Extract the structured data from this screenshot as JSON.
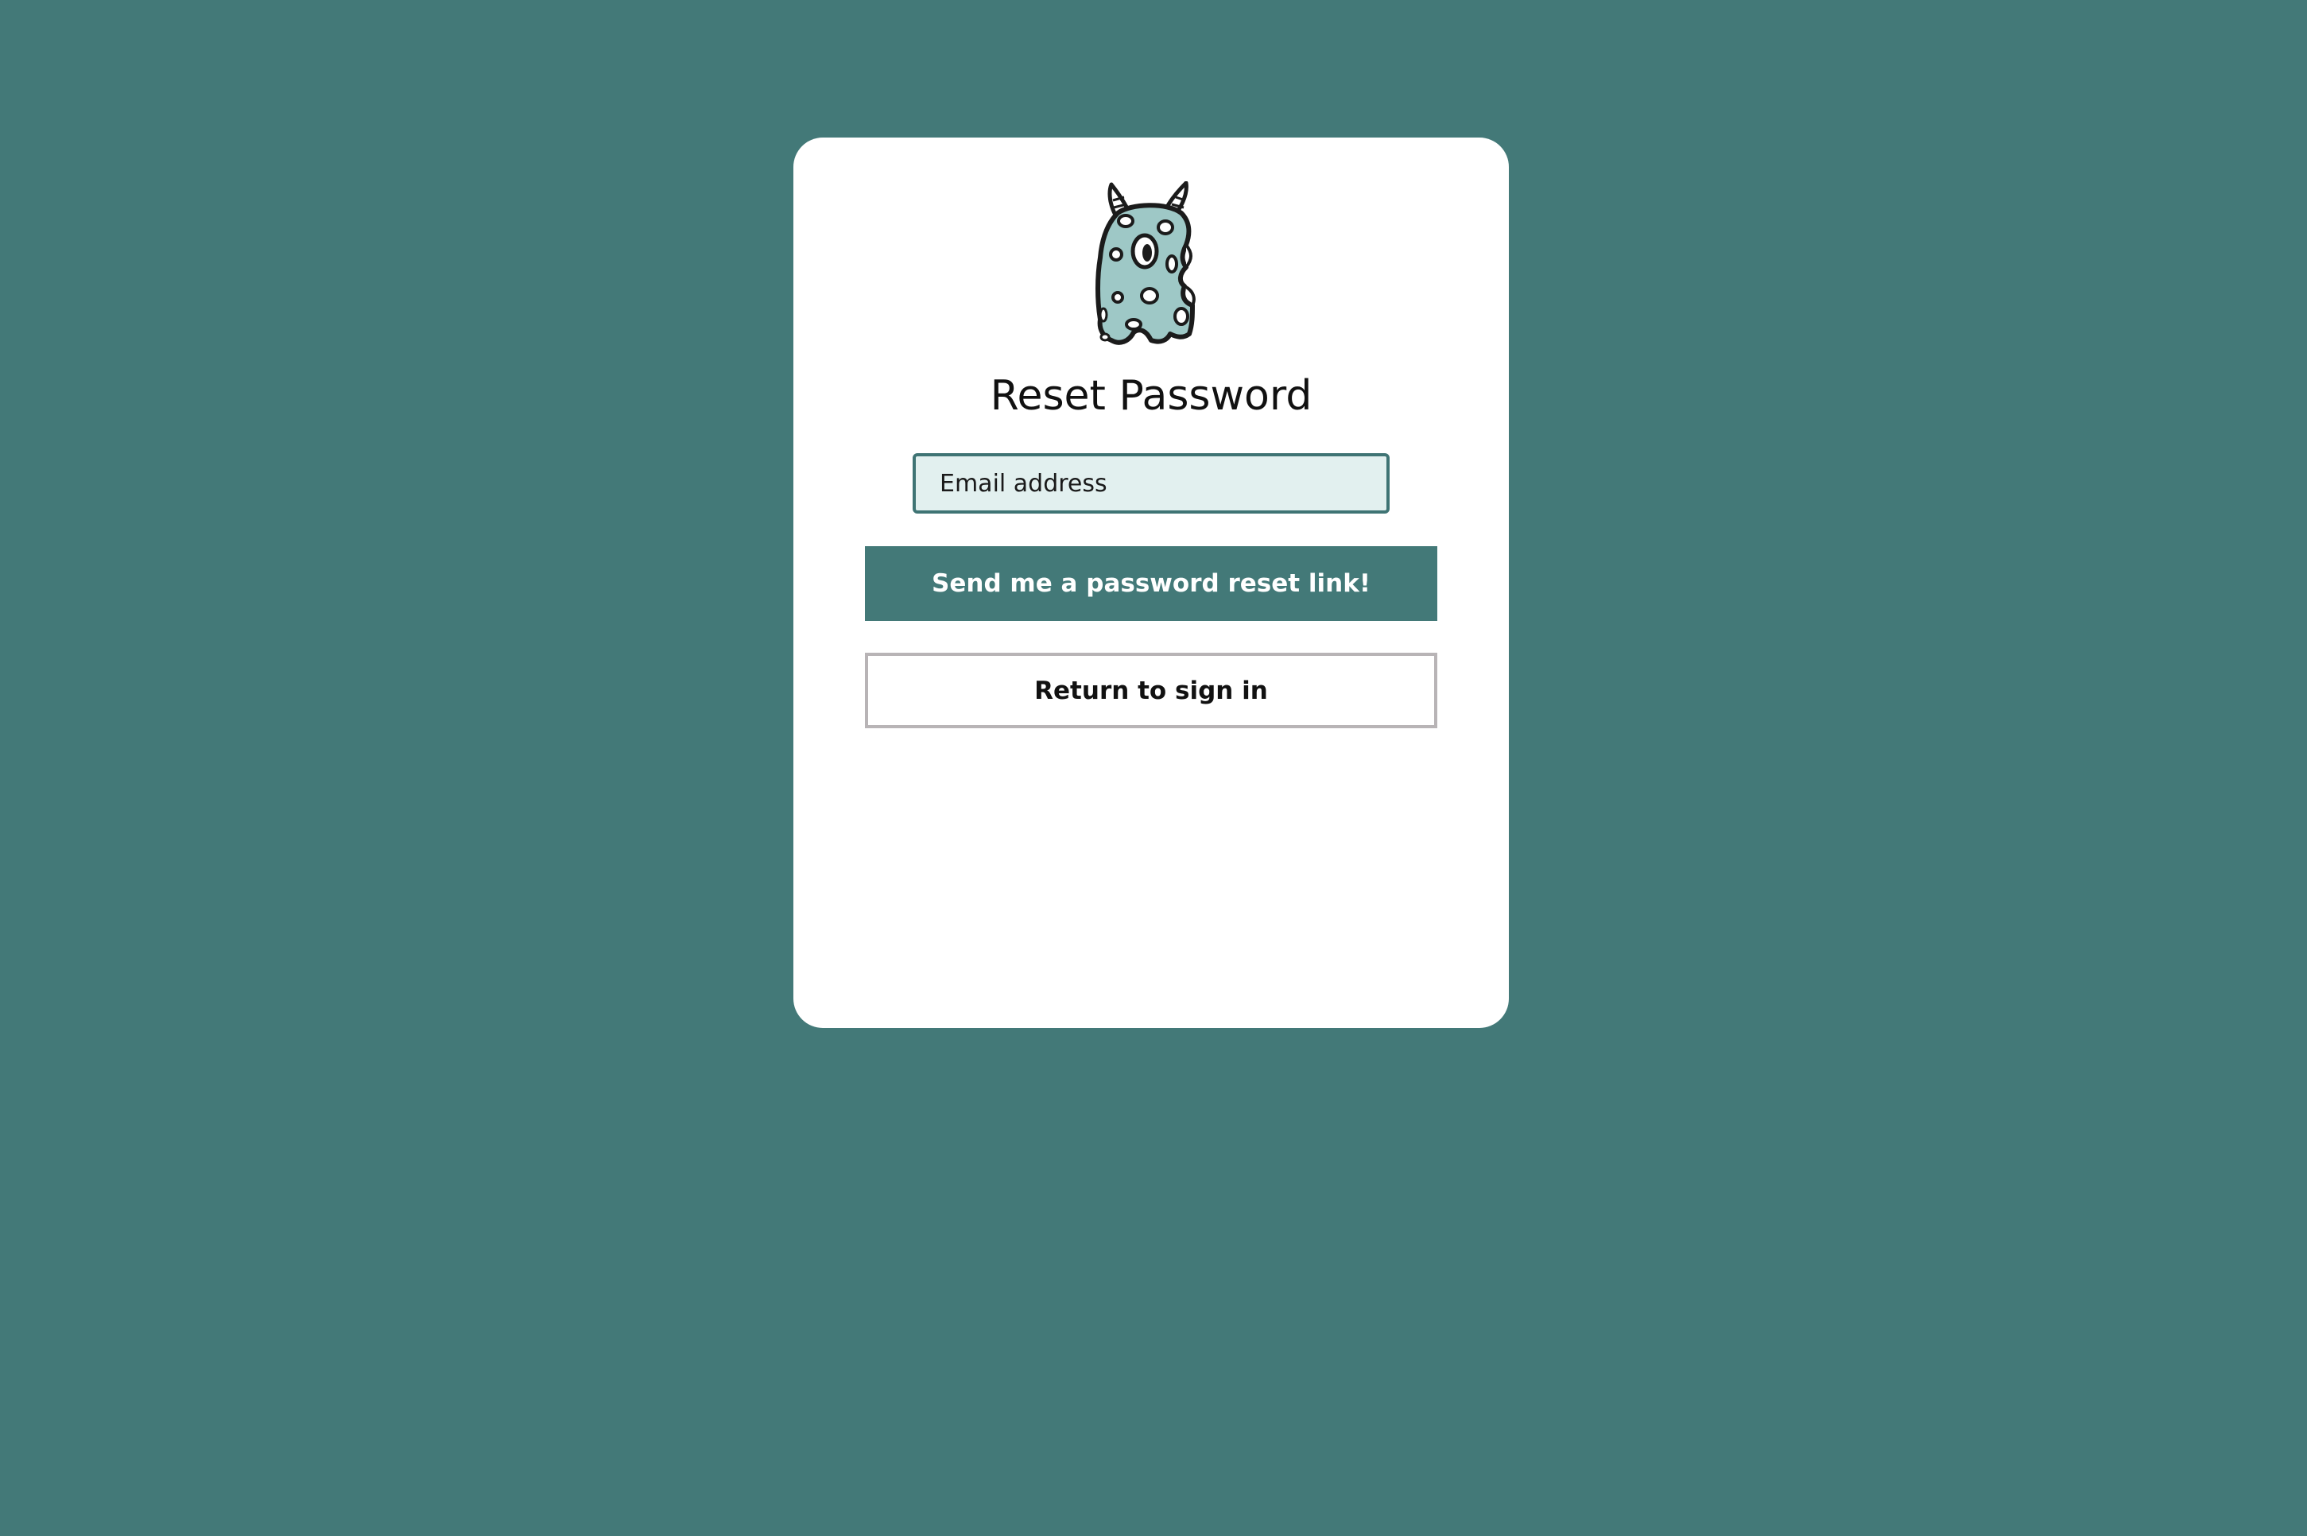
{
  "page": {
    "background_color": "#437978"
  },
  "card": {
    "logo_icon": "spotted-monster-logo",
    "title": "Reset Password",
    "email_field": {
      "placeholder": "Email address",
      "value": ""
    },
    "send_button_label": "Send me a password reset link!",
    "return_button_label": "Return to sign in"
  },
  "colors": {
    "accent": "#437978",
    "monster_fill": "#9ec8c6",
    "input_background": "#e2f0ef",
    "secondary_border": "#b8b4b6"
  }
}
